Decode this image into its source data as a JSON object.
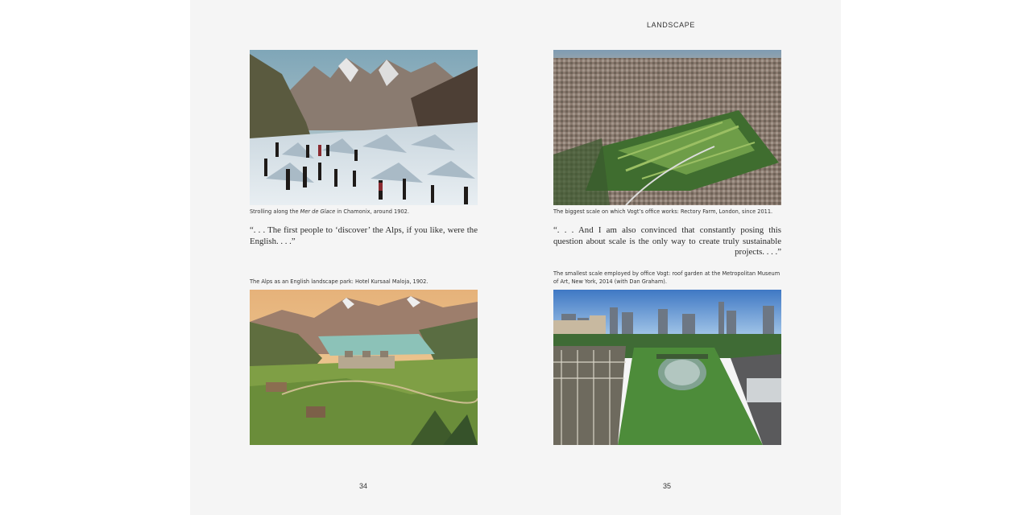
{
  "header": {
    "section_title": "LANDSCAPE"
  },
  "left_page": {
    "figure1": {
      "caption_pre": "Strolling along the ",
      "caption_italic": "Mer de Glace",
      "caption_post": " in Chamonix, around 1902."
    },
    "quote": "“. . . The first people to ‘discover’ the Alps, if you like, were the English. . . .”",
    "figure2": {
      "caption": "The Alps as an English landscape park: Hotel Kursaal Maloja, 1902."
    },
    "page_number": "34"
  },
  "right_page": {
    "figure1": {
      "caption": "The biggest scale on which Vogt’s office works: Rectory Farm, London, since 2011."
    },
    "quote": "“. . . And I am also convinced that constantly posing this question about scale is the only way to create truly sustainable projects. . . .”",
    "figure2": {
      "caption_line1": "The smallest scale employed by office Vogt: roof garden at the Metropolitan Museum",
      "caption_line2": "of Art, New York, 2014 (with Dan Graham)."
    },
    "page_number": "35"
  },
  "colors": {
    "paper": "#f5f5f5",
    "text": "#222222"
  }
}
